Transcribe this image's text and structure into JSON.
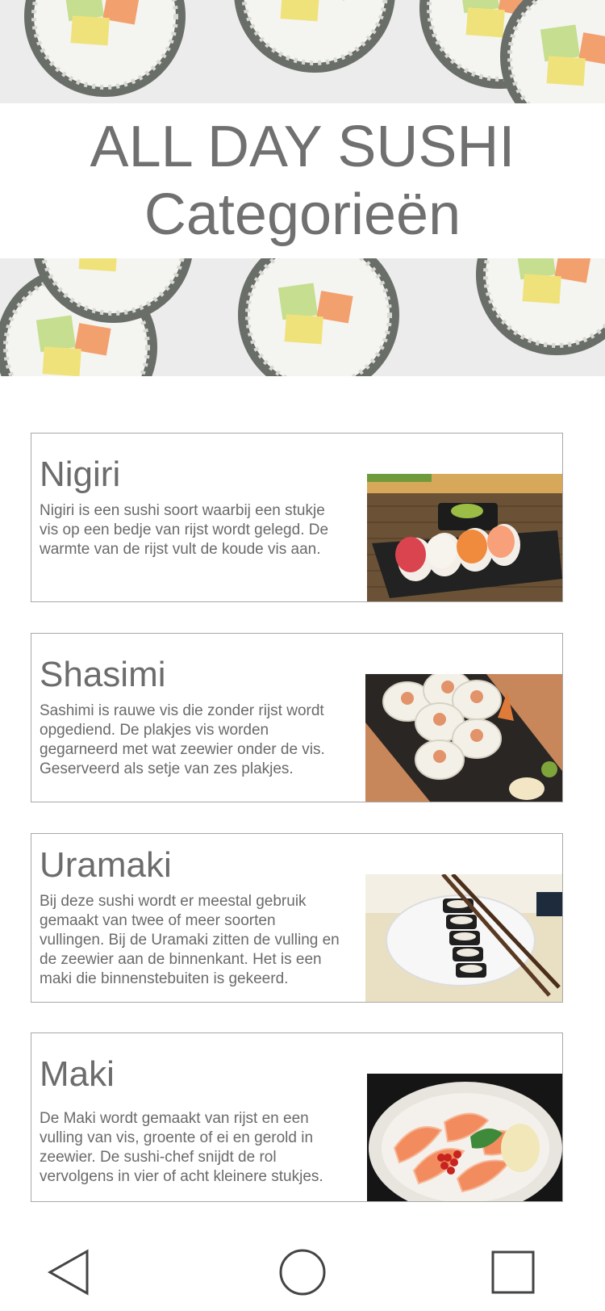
{
  "header": {
    "title": "ALL DAY SUSHI",
    "subtitle": "Categorieën"
  },
  "categories": [
    {
      "title": "Nigiri",
      "description": "Nigiri is een sushi soort waarbij een stukje vis op een bedje van rijst wordt gelegd. De warmte van de rijst vult de koude vis aan.",
      "image_icon": "nigiri-photo"
    },
    {
      "title": "Shasimi",
      "description": "Sashimi is rauwe vis die zonder rijst wordt opgediend. De plakjes vis worden gegarneerd met wat zeewier onder de vis. Geserveerd als setje van zes plakjes.",
      "image_icon": "sashimi-photo"
    },
    {
      "title": "Uramaki",
      "description": "Bij deze sushi wordt er meestal gebruik gemaakt van twee of meer soorten vullingen. Bij de Uramaki zitten de vulling en de zeewier aan de binnenkant. Het is een maki die binnenstebuiten is gekeerd.",
      "image_icon": "uramaki-photo"
    },
    {
      "title": "Maki",
      "description": "De Maki wordt gemaakt van rijst en een vulling van vis, groente of ei en gerold in zeewier. De sushi-chef snijdt de rol vervolgens in vier of acht kleinere stukjes.",
      "image_icon": "maki-photo"
    }
  ],
  "navigation": {
    "back_icon": "back-triangle-icon",
    "home_icon": "home-circle-icon",
    "recents_icon": "recents-square-icon"
  },
  "colors": {
    "text": "#707070",
    "border": "#a8a8a8",
    "salmon": "#f08a5d",
    "seaweed": "#4a4f4a",
    "cucumber": "#b8d98a"
  }
}
